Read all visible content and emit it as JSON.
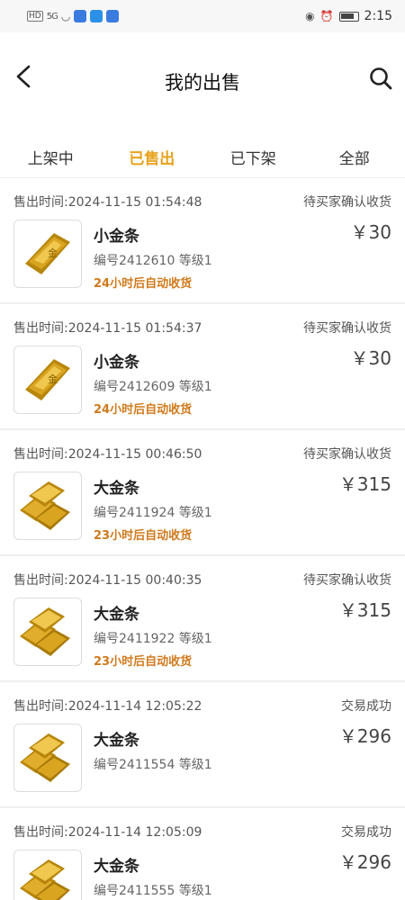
{
  "statusbar": {
    "time": "2:15",
    "hd": "HD",
    "signal": "5G"
  },
  "header": {
    "title": "我的出售"
  },
  "tabs": [
    {
      "label": "上架中",
      "active": false
    },
    {
      "label": "已售出",
      "active": true
    },
    {
      "label": "已下架",
      "active": false
    },
    {
      "label": "全部",
      "active": false
    }
  ],
  "items": [
    {
      "time": "售出时间:2024-11-15 01:54:48",
      "status": "待买家确认收货",
      "name": "小金条",
      "meta": "编号2412610 等级1",
      "note": "24小时后自动收货",
      "price": "￥30",
      "icon": "small-gold-bar"
    },
    {
      "time": "售出时间:2024-11-15 01:54:37",
      "status": "待买家确认收货",
      "name": "小金条",
      "meta": "编号2412609 等级1",
      "note": "24小时后自动收货",
      "price": "￥30",
      "icon": "small-gold-bar"
    },
    {
      "time": "售出时间:2024-11-15 00:46:50",
      "status": "待买家确认收货",
      "name": "大金条",
      "meta": "编号2411924 等级1",
      "note": "23小时后自动收货",
      "price": "￥315",
      "icon": "big-gold-bars"
    },
    {
      "time": "售出时间:2024-11-15 00:40:35",
      "status": "待买家确认收货",
      "name": "大金条",
      "meta": "编号2411922 等级1",
      "note": "23小时后自动收货",
      "price": "￥315",
      "icon": "big-gold-bars"
    },
    {
      "time": "售出时间:2024-11-14 12:05:22",
      "status": "交易成功",
      "name": "大金条",
      "meta": "编号2411554 等级1",
      "note": "",
      "price": "￥296",
      "icon": "big-gold-bars"
    },
    {
      "time": "售出时间:2024-11-14 12:05:09",
      "status": "交易成功",
      "name": "大金条",
      "meta": "编号2411555 等级1",
      "note": "",
      "price": "￥296",
      "icon": "big-gold-bars"
    }
  ],
  "colors": {
    "accent": "#e8a21c",
    "note": "#d07a1c"
  }
}
